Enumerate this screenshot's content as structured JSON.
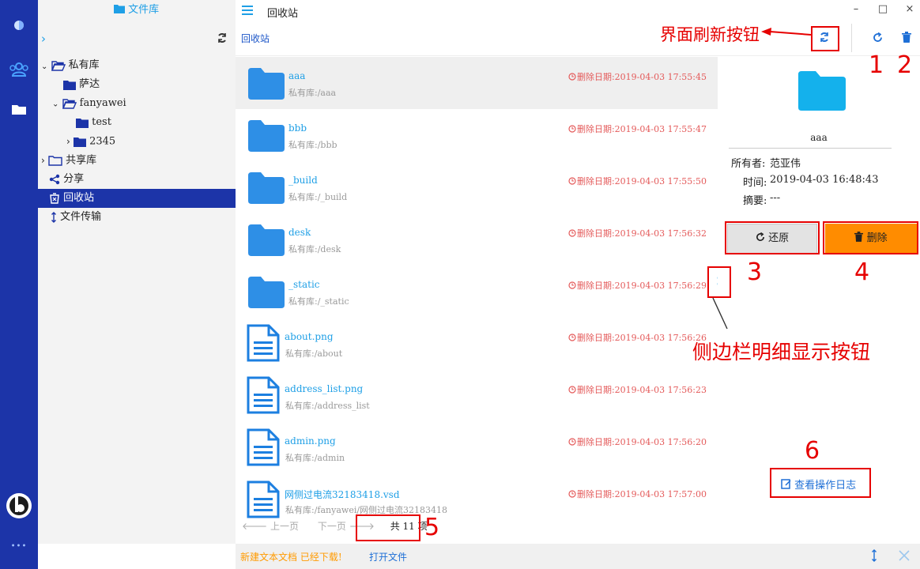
{
  "rail": {
    "more_label": "•••"
  },
  "tree": {
    "header": "文件库",
    "items": [
      {
        "label": "私有库"
      },
      {
        "label": "萨达"
      },
      {
        "label": "fanyawei"
      },
      {
        "label": "test"
      },
      {
        "label": "2345"
      },
      {
        "label": "共享库"
      },
      {
        "label": "分享"
      },
      {
        "label": "回收站"
      },
      {
        "label": "文件传输"
      }
    ]
  },
  "header": {
    "title": "回收站",
    "breadcrumb": "回收站"
  },
  "files": [
    {
      "name": "aaa",
      "path": "私有库:/aaa",
      "date": "删除日期:2019-04-03 17:55:45",
      "type": "folder"
    },
    {
      "name": "bbb",
      "path": "私有库:/bbb",
      "date": "删除日期:2019-04-03 17:55:47",
      "type": "folder"
    },
    {
      "name": "_build",
      "path": "私有库:/_build",
      "date": "删除日期:2019-04-03 17:55:50",
      "type": "folder"
    },
    {
      "name": "desk",
      "path": "私有库:/desk",
      "date": "删除日期:2019-04-03 17:56:32",
      "type": "folder"
    },
    {
      "name": "_static",
      "path": "私有库:/_static",
      "date": "删除日期:2019-04-03 17:56:29",
      "type": "folder"
    },
    {
      "name": "about.png",
      "path": "私有库:/about",
      "date": "删除日期:2019-04-03 17:56:26",
      "type": "doc"
    },
    {
      "name": "address_list.png",
      "path": "私有库:/address_list",
      "date": "删除日期:2019-04-03 17:56:23",
      "type": "doc"
    },
    {
      "name": "admin.png",
      "path": "私有库:/admin",
      "date": "删除日期:2019-04-03 17:56:20",
      "type": "doc"
    },
    {
      "name": "网侧过电流32183418.vsd",
      "path": "私有库:/fanyawei/网侧过电流32183418",
      "date": "删除日期:2019-04-03 17:57:00",
      "type": "doc"
    }
  ],
  "pagination": {
    "prev": "上一页",
    "next": "下一页",
    "total": "共 11 项"
  },
  "detail": {
    "name": "aaa",
    "owner_label": "所有者:",
    "owner_value": "范亚伟",
    "time_label": "时间:",
    "time_value": "2019-04-03 16:48:43",
    "summary_label": "摘要:",
    "summary_value": "---",
    "restore_label": "还原",
    "delete_label": "删除",
    "log_label": "查看操作日志"
  },
  "footer": {
    "status": "新建文本文档 已经下载!",
    "open_file": "打开文件"
  },
  "annotations": {
    "refresh_label": "界面刷新按钮",
    "sidebar_label": "侧边栏明细显示按钮",
    "n1": "1",
    "n2": "2",
    "n3": "3",
    "n4": "4",
    "n5": "5",
    "n6": "6"
  },
  "colors": {
    "rail": "#1c34a8",
    "accent_blue": "#1e9fe6",
    "delete_orange": "#ff8c00",
    "date_red": "#e45a5a",
    "annotation_red": "#e60000"
  }
}
